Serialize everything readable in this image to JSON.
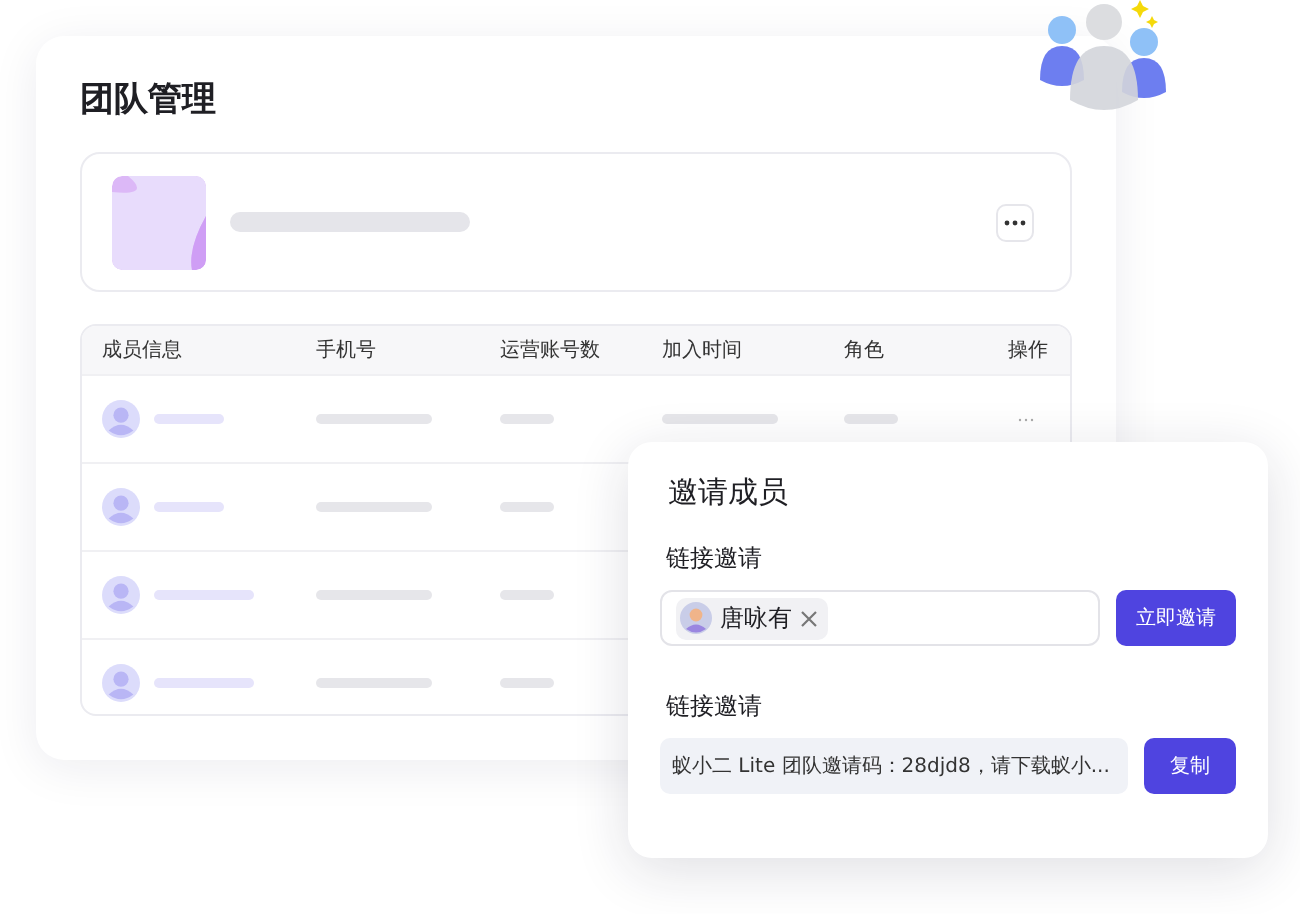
{
  "page": {
    "title": "团队管理"
  },
  "table": {
    "columns": [
      "成员信息",
      "手机号",
      "运营账号数",
      "加入时间",
      "角色",
      "操作"
    ]
  },
  "invite_dialog": {
    "title": "邀请成员",
    "direct_invite": {
      "label": "链接邀请",
      "chips": [
        {
          "name": "唐咏有"
        }
      ],
      "button": "立即邀请"
    },
    "link_invite": {
      "label": "链接邀请",
      "code_text": "蚁小二 Lite 团队邀请码：28djd8，请下载蚁小...",
      "button": "复制"
    }
  }
}
